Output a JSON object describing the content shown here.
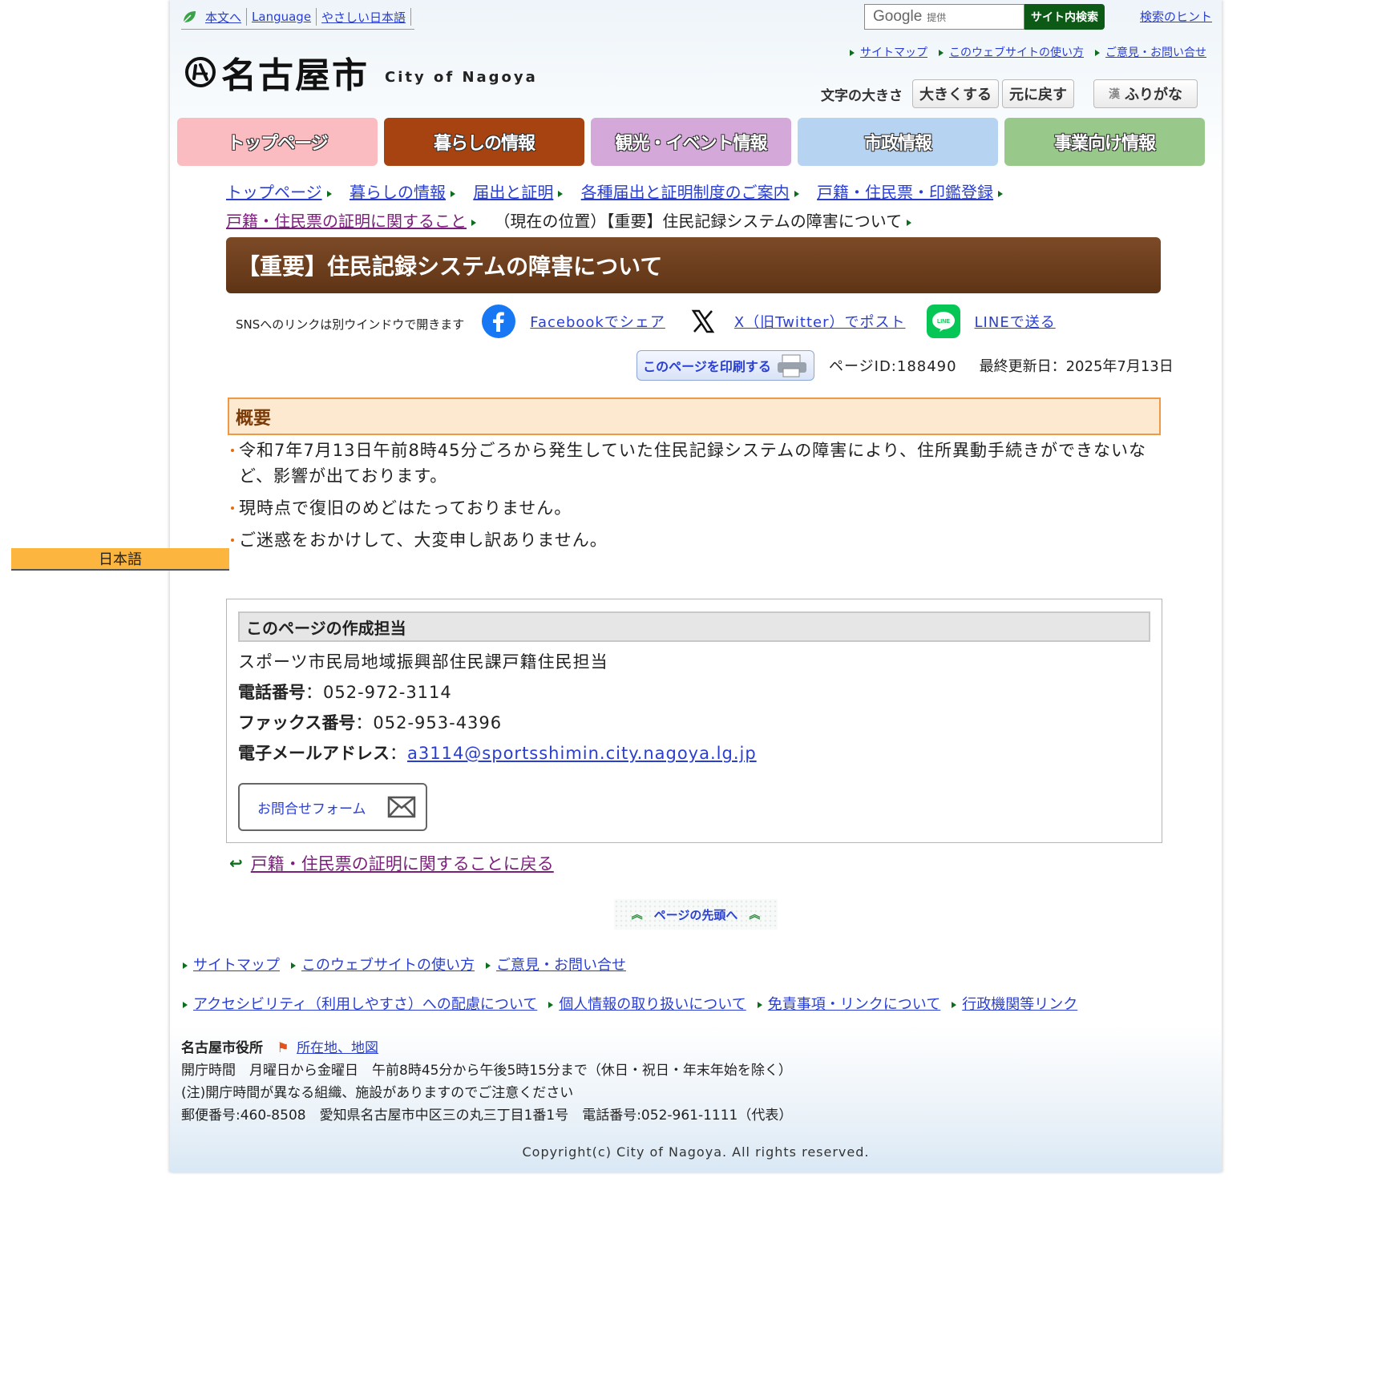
{
  "util": {
    "skip": "本文へ",
    "language": "Language",
    "easy": "やさしい日本語"
  },
  "search": {
    "google": "Google",
    "provided": "提供",
    "button": "サイト内検索",
    "hint": "検索のヒント"
  },
  "toplinks": [
    "サイトマップ",
    "このウェブサイトの使い方",
    "ご意見・お問い合せ"
  ],
  "logo": {
    "jp": "名古屋市",
    "en": "City of Nagoya"
  },
  "fontsize": {
    "label": "文字の大きさ",
    "larger": "大きくする",
    "reset": "元に戻す",
    "furigana": "ふりがな"
  },
  "nav": [
    {
      "label": "トップページ",
      "color": "#fbbcc1"
    },
    {
      "label": "暮らしの情報",
      "color": "#a64310"
    },
    {
      "label": "観光・イベント情報",
      "color": "#d4a8d8"
    },
    {
      "label": "市政情報",
      "color": "#b7d3f2"
    },
    {
      "label": "事業向け情報",
      "color": "#98c88a"
    }
  ],
  "breadcrumb": [
    "トップページ",
    "暮らしの情報",
    "届出と証明",
    "各種届出と証明制度のご案内",
    "戸籍・住民票・印鑑登録",
    "戸籍・住民票の証明に関すること",
    "（現在の位置）【重要】住民記録システムの障害について"
  ],
  "title": "【重要】住民記録システムの障害について",
  "sns": {
    "note": "SNSへのリンクは別ウインドウで開きます",
    "facebook": "Facebookでシェア",
    "x": "X（旧Twitter）でポスト",
    "line": "LINEで送る"
  },
  "print": {
    "button": "このページを印刷する",
    "page_id": "ページID:188490",
    "updated": "最終更新日：2025年7月13日"
  },
  "summary": {
    "heading": "概要",
    "items": [
      "令和7年7月13日午前8時45分ごろから発生していた住民記録システムの障害により、住所異動手続きができないなど、影響が出ております。",
      "現時点で復旧のめどはたっておりません。",
      "ご迷惑をおかけして、大変申し訳ありません。"
    ]
  },
  "contact": {
    "heading": "このページの作成担当",
    "dept": "スポーツ市民局地域振興部住民課戸籍住民担当",
    "tel_label": "電話番号",
    "tel": "：052-972-3114",
    "fax_label": "ファックス番号",
    "fax": "：052-953-4396",
    "mail_label": "電子メールアドレス",
    "mail_sep": "：",
    "mail": "a3114@sportsshimin.city.nagoya.lg.jp",
    "form": "お問合せフォーム"
  },
  "back": "戸籍・住民票の証明に関することに戻る",
  "totop": "ページの先頭へ",
  "footer_links_1": [
    "サイトマップ",
    "このウェブサイトの使い方",
    "ご意見・お問い合せ"
  ],
  "footer_links_2": [
    "アクセシビリティ（利用しやすさ）への配慮について",
    "個人情報の取り扱いについて",
    "免責事項・リンクについて",
    "行政機関等リンク"
  ],
  "office": {
    "name": "名古屋市役所",
    "map": "所在地、地図",
    "hours": "開庁時間　月曜日から金曜日　午前8時45分から午後5時15分まで（休日・祝日・年末年始を除く）",
    "note": "(注)開庁時間が異なる組織、施設がありますのでご注意ください",
    "address": "郵便番号:460-8508　愛知県名古屋市中区三の丸三丁目1番1号　電話番号:052-961-1111（代表）"
  },
  "copyright": "Copyright(c) City of Nagoya. All rights reserved.",
  "lang_tab": "日本語"
}
